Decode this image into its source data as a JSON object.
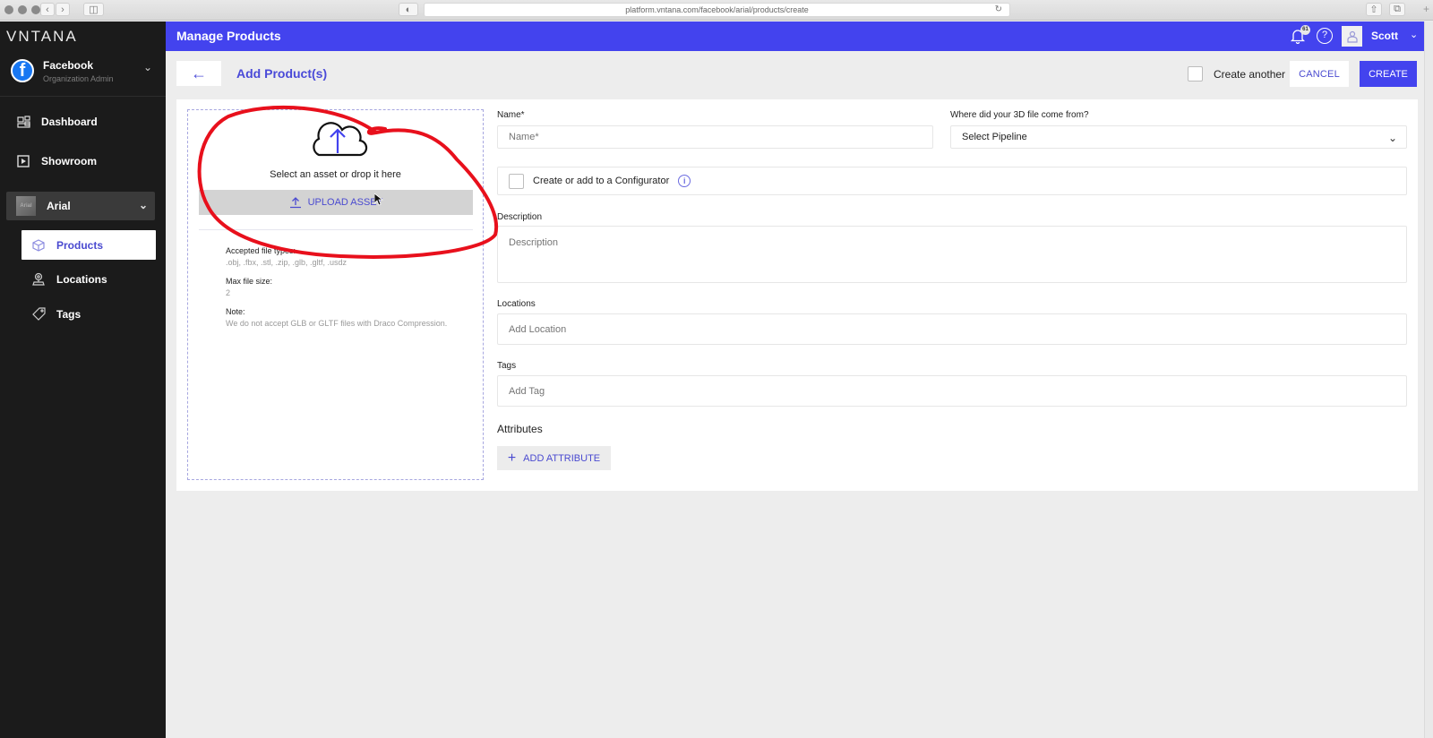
{
  "browser": {
    "url": "platform.vntana.com/facebook/arial/products/create"
  },
  "sidebar": {
    "brand": "VNTANA",
    "org": {
      "name": "Facebook",
      "role": "Organization Admin",
      "icon": "facebook-icon"
    },
    "items": [
      {
        "label": "Dashboard",
        "icon": "dashboard-icon"
      },
      {
        "label": "Showroom",
        "icon": "showroom-icon"
      }
    ],
    "group": {
      "label": "Arial",
      "thumb_text": "Arial",
      "expanded": true,
      "children": [
        {
          "label": "Products",
          "icon": "cube-icon",
          "active": true
        },
        {
          "label": "Locations",
          "icon": "location-pin-icon",
          "active": false
        },
        {
          "label": "Tags",
          "icon": "tag-icon",
          "active": false
        }
      ]
    }
  },
  "header": {
    "title": "Manage Products",
    "notifications_count": "61",
    "user_name": "Scott",
    "accent_color": "#4343ee"
  },
  "page": {
    "title": "Add Product(s)",
    "create_another_label": "Create another",
    "create_another_checked": false,
    "cancel_label": "CANCEL",
    "create_label": "CREATE"
  },
  "upload": {
    "prompt": "Select an asset or drop it here",
    "button_label": "UPLOAD ASSET",
    "accepted_label": "Accepted file types:",
    "accepted_value": ".obj, .fbx, .stl, .zip, .glb, .gltf, .usdz",
    "max_size_label": "Max file size:",
    "max_size_value": "2",
    "note_label": "Note:",
    "note_value": "We do not accept GLB or GLTF files with Draco Compression."
  },
  "form": {
    "name_label": "Name*",
    "name_placeholder": "Name*",
    "name_value": "",
    "pipeline_label": "Where did your 3D file come from?",
    "pipeline_value": "Select Pipeline",
    "configurator_label": "Create or add to a Configurator",
    "configurator_checked": false,
    "description_label": "Description",
    "description_placeholder": "Description",
    "locations_label": "Locations",
    "locations_placeholder": "Add Location",
    "tags_label": "Tags",
    "tags_placeholder": "Add Tag",
    "attributes_label": "Attributes",
    "add_attribute_label": "ADD ATTRIBUTE"
  }
}
